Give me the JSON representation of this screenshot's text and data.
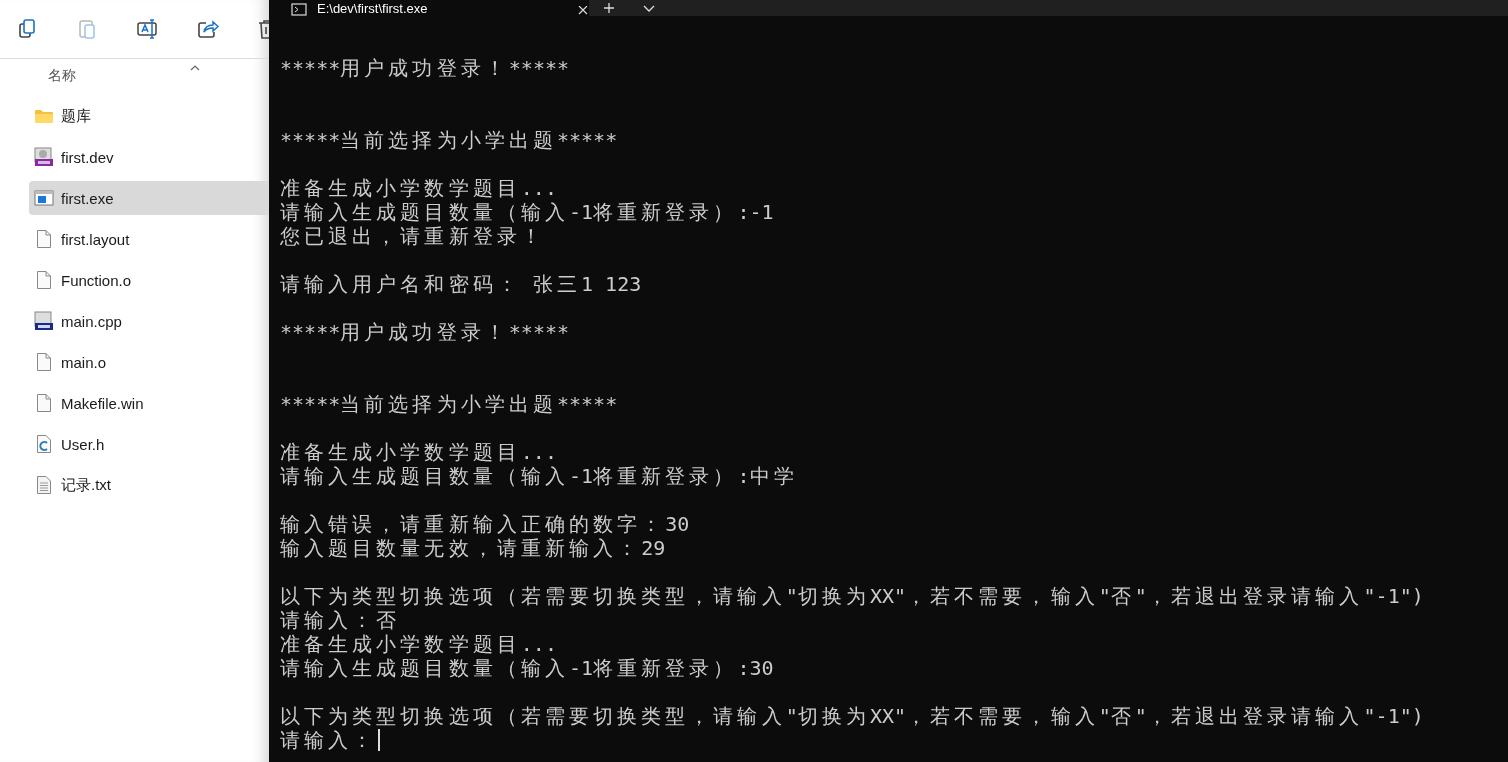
{
  "explorer": {
    "toolbar": [
      {
        "kind": "copy",
        "disabled": false
      },
      {
        "kind": "paste",
        "disabled": true
      },
      {
        "kind": "rename",
        "disabled": false
      },
      {
        "kind": "share",
        "disabled": false
      },
      {
        "kind": "delete",
        "disabled": false
      }
    ],
    "column_header": {
      "label": "名称",
      "sorted": true
    },
    "files": [
      {
        "name": "题库",
        "kind": "folder",
        "selected": false
      },
      {
        "name": "first.dev",
        "kind": "project",
        "selected": false
      },
      {
        "name": "first.exe",
        "kind": "exe",
        "selected": true
      },
      {
        "name": "first.layout",
        "kind": "file",
        "selected": false
      },
      {
        "name": "Function.o",
        "kind": "file",
        "selected": false
      },
      {
        "name": "main.cpp",
        "kind": "cpp",
        "selected": false
      },
      {
        "name": "main.o",
        "kind": "file",
        "selected": false
      },
      {
        "name": "Makefile.win",
        "kind": "file",
        "selected": false
      },
      {
        "name": "User.h",
        "kind": "header",
        "selected": false
      },
      {
        "name": "记录.txt",
        "kind": "text",
        "selected": false
      }
    ]
  },
  "terminal": {
    "tab_title": "E:\\dev\\first\\first.exe",
    "lines": [
      {
        "kind": "blank"
      },
      {
        "kind": "output",
        "text": "*****用户成功登录！*****"
      },
      {
        "kind": "blank"
      },
      {
        "kind": "blank"
      },
      {
        "kind": "output",
        "text": "*****当前选择为小学出题*****"
      },
      {
        "kind": "blank"
      },
      {
        "kind": "output",
        "text": "准备生成小学数学题目..."
      },
      {
        "kind": "output",
        "text": "请输入生成题目数量（输入-1将重新登录）:-1"
      },
      {
        "kind": "output",
        "text": "您已退出，请重新登录！"
      },
      {
        "kind": "blank"
      },
      {
        "kind": "output",
        "text": "请输入用户名和密码： 张三1 123"
      },
      {
        "kind": "blank"
      },
      {
        "kind": "output",
        "text": "*****用户成功登录！*****"
      },
      {
        "kind": "blank"
      },
      {
        "kind": "blank"
      },
      {
        "kind": "output",
        "text": "*****当前选择为小学出题*****"
      },
      {
        "kind": "blank"
      },
      {
        "kind": "output",
        "text": "准备生成小学数学题目..."
      },
      {
        "kind": "output",
        "text": "请输入生成题目数量（输入-1将重新登录）:中学"
      },
      {
        "kind": "blank"
      },
      {
        "kind": "output",
        "text": "输入错误，请重新输入正确的数字：30"
      },
      {
        "kind": "output",
        "text": "输入题目数量无效，请重新输入：29"
      },
      {
        "kind": "blank"
      },
      {
        "kind": "output",
        "text": "以下为类型切换选项（若需要切换类型，请输入\"切换为XX\"，若不需要，输入\"否\"，若退出登录请输入\"-1\")"
      },
      {
        "kind": "output",
        "text": "请输入：否"
      },
      {
        "kind": "output",
        "text": "准备生成小学数学题目..."
      },
      {
        "kind": "output",
        "text": "请输入生成题目数量（输入-1将重新登录）:30"
      },
      {
        "kind": "blank"
      },
      {
        "kind": "output",
        "text": "以下为类型切换选项（若需要切换类型，请输入\"切换为XX\"，若不需要，输入\"否\"，若退出登录请输入\"-1\")"
      },
      {
        "kind": "prompt",
        "text": "请输入：",
        "cursor": true
      }
    ]
  }
}
